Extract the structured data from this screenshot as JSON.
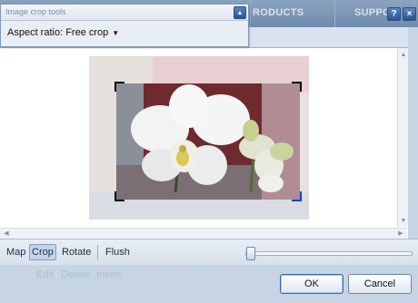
{
  "app_nav": {
    "products": "RODUCTS",
    "support": "SUPPO"
  },
  "title_buttons": {
    "help": "?",
    "close": "×"
  },
  "crop_panel": {
    "title": "Image crop tools",
    "collapse_icon": "▲",
    "aspect_ratio_label": "Aspect ratio: Free crop",
    "aspect_ratio_caret": "▼"
  },
  "toolbar": {
    "map": "Map",
    "crop": "Crop",
    "rotate": "Rotate",
    "flush": "Flush",
    "active_tool": "Crop"
  },
  "zoom_slider": {
    "value_fraction": 0.02
  },
  "background_actions": {
    "edit": "Edit",
    "delete": "Delete",
    "insert": "Insert"
  },
  "buttons": {
    "ok": "OK",
    "cancel": "Cancel"
  },
  "icons": {
    "help": "help-icon",
    "close": "close-icon",
    "collapse": "chevron-up-icon",
    "dropdown": "chevron-down-icon"
  },
  "colors": {
    "accent": "#2a5394",
    "crop_handle": "#000000",
    "crop_handle_active": "#1a3cd6"
  }
}
